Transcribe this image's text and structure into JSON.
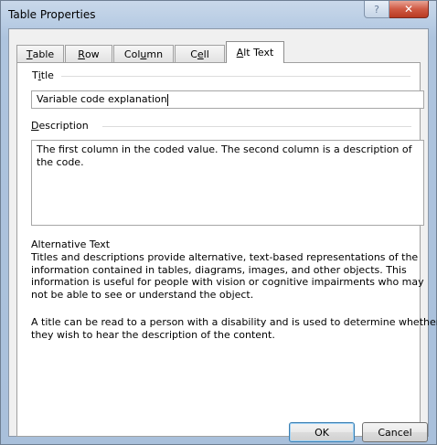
{
  "window": {
    "title": "Table Properties",
    "help_glyph": "?",
    "close_glyph": "✕"
  },
  "tabs": [
    {
      "label_pre": "",
      "mnemonic": "T",
      "label_post": "able"
    },
    {
      "label_pre": "",
      "mnemonic": "R",
      "label_post": "ow"
    },
    {
      "label_pre": "Col",
      "mnemonic": "u",
      "label_post": "mn"
    },
    {
      "label_pre": "C",
      "mnemonic": "e",
      "label_post": "ll"
    },
    {
      "label_pre": "",
      "mnemonic": "A",
      "label_post": "lt Text"
    }
  ],
  "active_tab": "Alt Text",
  "alt_text": {
    "title_label_pre": "T",
    "title_label_mnemonic": "i",
    "title_label_post": "tle",
    "title_value": "Variable code explanation",
    "description_label_mnemonic": "D",
    "description_label_post": "escription",
    "description_value": "The first column in the coded value. The second column is a description of the code.",
    "heading": "Alternative Text",
    "paragraph1": "Titles and descriptions provide alternative, text-based representations of the information contained in tables, diagrams, images, and other objects. This information is useful for people with vision or cognitive impairments who may not be able to see or understand the object.",
    "paragraph2": "A title can be read to a person with a disability and is used to determine whether they wish to hear the description of the content."
  },
  "buttons": {
    "ok": "OK",
    "cancel": "Cancel"
  },
  "colors": {
    "frame": "#aec4de",
    "close_button": "#c8452e",
    "ok_border": "#3c7fb1"
  }
}
